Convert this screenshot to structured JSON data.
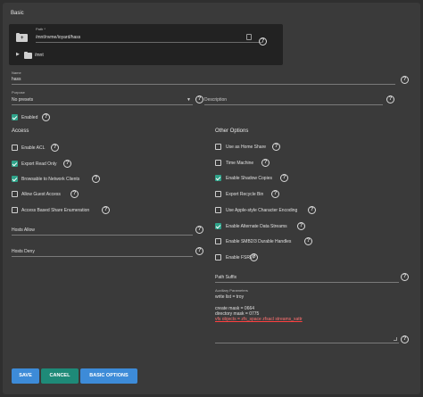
{
  "sections": {
    "basic": "Basic",
    "access": "Access",
    "other": "Other Options"
  },
  "path": {
    "label": "Path *",
    "value": "/mnt/nvme/ioyard/hass",
    "tree_item": "/mnt"
  },
  "name": {
    "label": "Name",
    "value": "hass"
  },
  "purpose": {
    "label": "Purpose",
    "value": "No presets"
  },
  "description": {
    "label": "Description",
    "value": ""
  },
  "enabled": {
    "label": "Enabled",
    "checked": true
  },
  "access": {
    "checkboxes": [
      {
        "label": "Enable ACL",
        "checked": false
      },
      {
        "label": "Export Read Only",
        "checked": true
      },
      {
        "label": "Browsable to Network Clients",
        "checked": true
      },
      {
        "label": "Allow Guest Access",
        "checked": false
      },
      {
        "label": "Access Based Share Enumeration",
        "checked": false
      }
    ],
    "hosts_allow": "Hosts Allow",
    "hosts_deny": "Hosts Deny"
  },
  "other": {
    "checkboxes": [
      {
        "label": "Use as Home Share",
        "checked": false
      },
      {
        "label": "Time Machine",
        "checked": false
      },
      {
        "label": "Enable Shadow Copies",
        "checked": true
      },
      {
        "label": "Export Recycle Bin",
        "checked": false
      },
      {
        "label": "Use Apple-style Character Encoding",
        "checked": false
      },
      {
        "label": "Enable Alternate Data Streams",
        "checked": true
      },
      {
        "label": "Enable SMB2/3 Durable Handles",
        "checked": false
      },
      {
        "label": "Enable FSRVP",
        "checked": false
      }
    ],
    "path_suffix": "Path Suffix",
    "aux_label": "Auxiliary Parameters",
    "aux_lines": [
      "write list = troy",
      "",
      "create mask = 0664",
      "directory mask = 0775"
    ],
    "aux_red_line": "vfs objects = zfs_space zfsacl streams_xattr"
  },
  "buttons": {
    "save": "SAVE",
    "cancel": "CANCEL",
    "basic_options": "BASIC OPTIONS"
  },
  "colors": {
    "save": "#3d8bd8",
    "cancel": "#1e8a78",
    "basic_options": "#3d8bd8",
    "checkbox_on": "#2fa38a"
  }
}
